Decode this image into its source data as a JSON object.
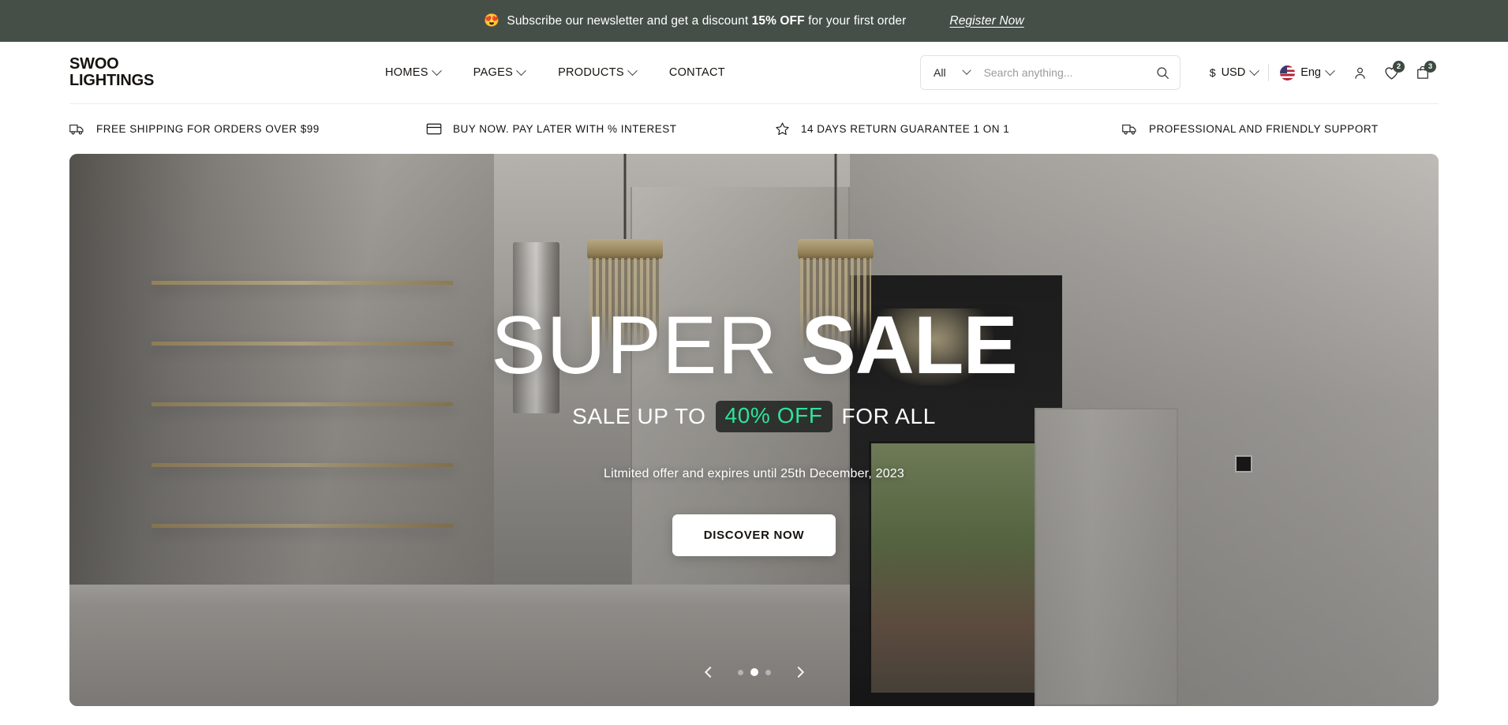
{
  "promo": {
    "emoji": "😍",
    "icon_name": "heart-eyes-emoji",
    "text_before": "Subscribe our newsletter and get a discount ",
    "highlight": "15% OFF",
    "text_after": " for your first order",
    "register_label": "Register Now",
    "bg_color": "#454F47"
  },
  "header": {
    "logo_line1": "SWOO",
    "logo_line2": "LIGHTINGS",
    "nav": [
      {
        "label": "HOMES",
        "has_dropdown": true
      },
      {
        "label": "PAGES",
        "has_dropdown": true
      },
      {
        "label": "PRODUCTS",
        "has_dropdown": true
      },
      {
        "label": "CONTACT",
        "has_dropdown": false
      }
    ],
    "search": {
      "category_selected": "All",
      "placeholder": "Search anything...",
      "value": "",
      "search_icon": "search-icon"
    },
    "currency": {
      "symbol": "$",
      "label": "USD"
    },
    "language": {
      "label": "Eng",
      "flag": "us-flag"
    },
    "account_icon": "user-icon",
    "wishlist": {
      "icon": "heart-icon",
      "count": "2"
    },
    "cart": {
      "icon": "shopping-bag-icon",
      "count": "3"
    },
    "badge_color": "#3c4a3f"
  },
  "features": [
    {
      "icon": "truck-icon",
      "label": "FREE SHIPPING FOR ORDERS OVER $99"
    },
    {
      "icon": "credit-card-icon",
      "label": "BUY NOW. PAY LATER WITH % INTEREST"
    },
    {
      "icon": "star-icon",
      "label": "14 DAYS RETURN GUARANTEE 1 ON 1"
    },
    {
      "icon": "truck-icon",
      "label": "PROFESSIONAL AND FRIENDLY SUPPORT"
    }
  ],
  "hero": {
    "title_thin": "SUPER",
    "title_bold": "SALE",
    "sub_before": "SALE UP TO",
    "sub_highlight": "40% OFF",
    "sub_after": "FOR ALL",
    "highlight_color": "#2FE39A",
    "note": "Litmited offer and expires until 25th December, 2023",
    "cta_label": "DISCOVER NOW",
    "carousel": {
      "prev_icon": "chevron-left-icon",
      "next_icon": "chevron-right-icon",
      "slide_count": 3,
      "active_slide": 1
    }
  }
}
